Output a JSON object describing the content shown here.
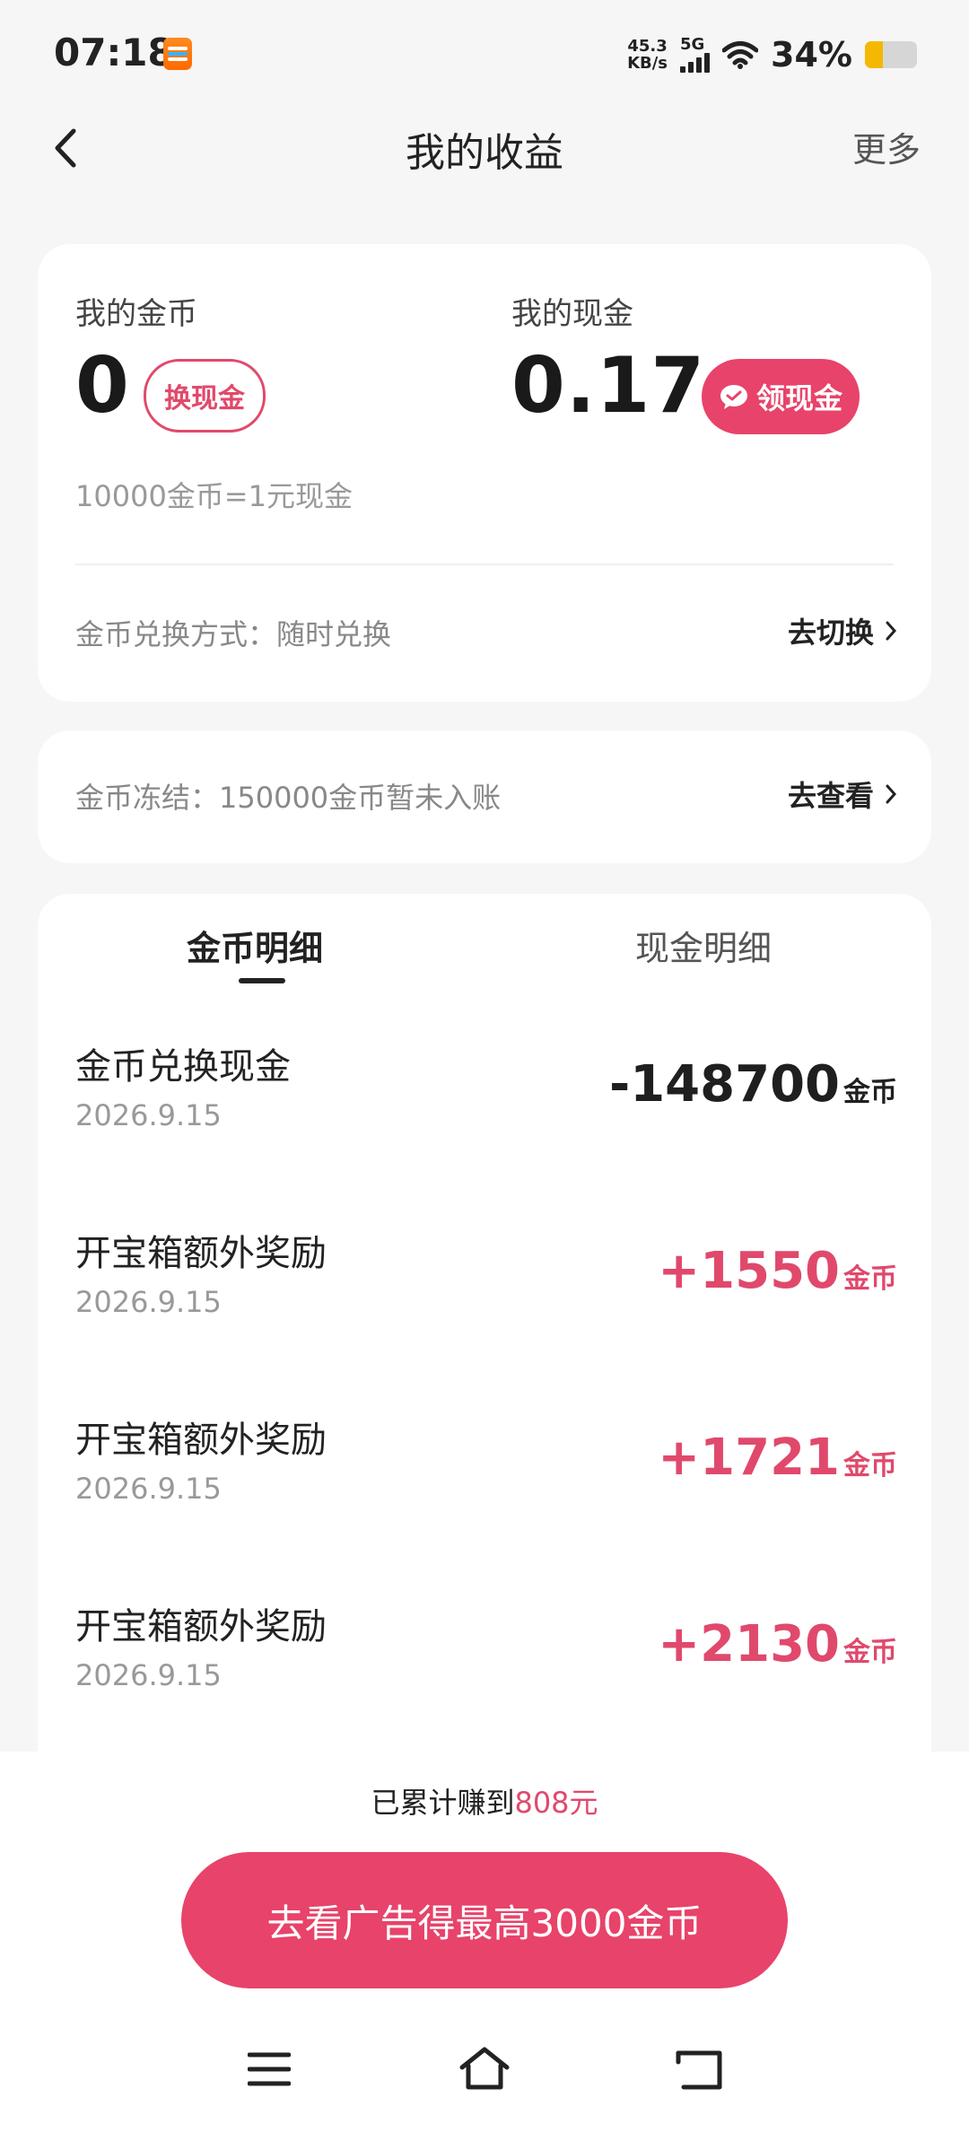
{
  "status_bar": {
    "time": "07:18",
    "net_speed_value": "45.3",
    "net_speed_unit": "KB/s",
    "network": "5G",
    "battery_pct": "34%",
    "battery_level": 0.34,
    "app_icon": "taobao-flash-sale-icon"
  },
  "header": {
    "title": "我的收益",
    "more_label": "更多",
    "back_icon": "chevron-left-icon"
  },
  "summary": {
    "coins_label": "我的金币",
    "coins_value": "0",
    "exchange_btn": "换现金",
    "cash_label": "我的现金",
    "cash_value": "0.17",
    "withdraw_btn": "领现金",
    "rate_hint": "10000金币=1元现金",
    "exchange_mode_label": "金币兑换方式：随时兑换",
    "switch_label": "去切换"
  },
  "frozen": {
    "text": "金币冻结：150000金币暂未入账",
    "view_label": "去查看"
  },
  "tabs": [
    {
      "label": "金币明细",
      "active": true
    },
    {
      "label": "现金明细",
      "active": false
    }
  ],
  "records": [
    {
      "title": "金币兑换现金",
      "date": "2026.9.15",
      "amount": "-148700",
      "unit": "金币",
      "sign": "neg"
    },
    {
      "title": "开宝箱额外奖励",
      "date": "2026.9.15",
      "amount": "+1550",
      "unit": "金币",
      "sign": "pos"
    },
    {
      "title": "开宝箱额外奖励",
      "date": "2026.9.15",
      "amount": "+1721",
      "unit": "金币",
      "sign": "pos"
    },
    {
      "title": "开宝箱额外奖励",
      "date": "2026.9.15",
      "amount": "+2130",
      "unit": "金币",
      "sign": "pos"
    }
  ],
  "footer": {
    "earned_prefix": "已累计赚到",
    "earned_amount": "808元",
    "cta_label": "去看广告得最高3000金币"
  },
  "colors": {
    "accent": "#e8436a",
    "positive": "#e0496c",
    "background": "#f6f6f6"
  }
}
